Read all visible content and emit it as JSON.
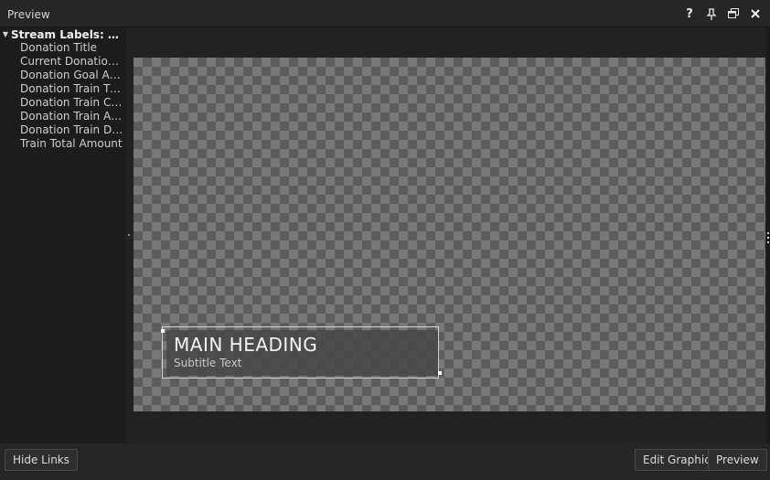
{
  "window": {
    "title": "Preview",
    "controls": [
      "help-icon",
      "pin-icon",
      "restore-icon",
      "close-icon"
    ]
  },
  "sidebar": {
    "root_label": "Stream Labels: Don...",
    "items": [
      "Donation Title",
      "Current Donation ...",
      "Donation Goal Am...",
      "Donation Train Time",
      "Donation Train Co...",
      "Donation Train Am...",
      "Donation Train Do...",
      "Train Total Amount"
    ]
  },
  "graphic": {
    "heading": "MAIN HEADING",
    "subtitle": "Subtitle Text"
  },
  "footer": {
    "hide_links": "Hide Links",
    "edit_graphic": "Edit Graphic",
    "preview": "Preview"
  },
  "colors": {
    "background": "#1e1e1e",
    "checker_light": "#787878",
    "checker_dark": "#5d5d5d"
  }
}
